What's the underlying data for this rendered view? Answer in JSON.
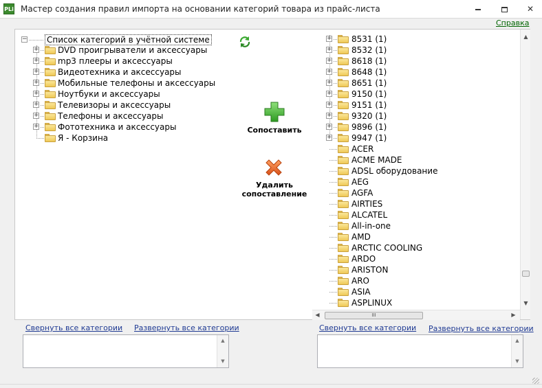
{
  "window": {
    "title": "Мастер создания правил импорта на основании категорий товара из прайс-листа",
    "app_icon_text": "PLi"
  },
  "help_link": "Справка",
  "left_tree": {
    "root": "Список категорий в учётной системе",
    "items": [
      {
        "label": "DVD проигрыватели и аксессуары",
        "expandable": true
      },
      {
        "label": "mp3 плееры и аксессуары",
        "expandable": true
      },
      {
        "label": "Видеотехника и аксессуары",
        "expandable": true
      },
      {
        "label": "Мобильные телефоны и аксессуары",
        "expandable": true
      },
      {
        "label": "Ноутбуки и аксессуары",
        "expandable": true
      },
      {
        "label": "Телевизоры и аксессуары",
        "expandable": true
      },
      {
        "label": "Телефоны и аксессуары",
        "expandable": true
      },
      {
        "label": "Фототехника и аксессуары",
        "expandable": true
      },
      {
        "label": "Я - Корзина",
        "expandable": false
      }
    ]
  },
  "actions": {
    "map_label": "Сопоставить",
    "unmap_label_line1": "Удалить",
    "unmap_label_line2": "сопоставление"
  },
  "right_tree": {
    "items": [
      {
        "label": "8531 (1)",
        "expandable": true
      },
      {
        "label": "8532 (1)",
        "expandable": true
      },
      {
        "label": "8618 (1)",
        "expandable": true
      },
      {
        "label": "8648 (1)",
        "expandable": true
      },
      {
        "label": "8651 (1)",
        "expandable": true
      },
      {
        "label": "9150 (1)",
        "expandable": true
      },
      {
        "label": "9151 (1)",
        "expandable": true
      },
      {
        "label": "9320 (1)",
        "expandable": true
      },
      {
        "label": "9896 (1)",
        "expandable": true
      },
      {
        "label": "9947 (1)",
        "expandable": true
      },
      {
        "label": "ACER",
        "expandable": false
      },
      {
        "label": "ACME MADE",
        "expandable": false
      },
      {
        "label": "ADSL оборудование",
        "expandable": false
      },
      {
        "label": "AEG",
        "expandable": false
      },
      {
        "label": "AGFA",
        "expandable": false
      },
      {
        "label": "AIRTIES",
        "expandable": false
      },
      {
        "label": "ALCATEL",
        "expandable": false
      },
      {
        "label": "All-in-one",
        "expandable": false
      },
      {
        "label": "AMD",
        "expandable": false
      },
      {
        "label": "ARCTIC COOLING",
        "expandable": false
      },
      {
        "label": "ARDO",
        "expandable": false
      },
      {
        "label": "ARISTON",
        "expandable": false
      },
      {
        "label": "ARO",
        "expandable": false
      },
      {
        "label": "ASIA",
        "expandable": false
      },
      {
        "label": "ASPLINUX",
        "expandable": false
      }
    ]
  },
  "bottom_left": {
    "collapse_all": "Свернуть все категории",
    "expand_all": "Развернуть все категории"
  },
  "bottom_right": {
    "collapse_all": "Свернуть все категории",
    "expand_all": "Развернуть все категории"
  },
  "scroll_grip": "III",
  "colors": {
    "help_link": "#006400",
    "link": "#1f3a93",
    "plus_green": "#3aa830",
    "delete_orange": "#e8642a"
  }
}
